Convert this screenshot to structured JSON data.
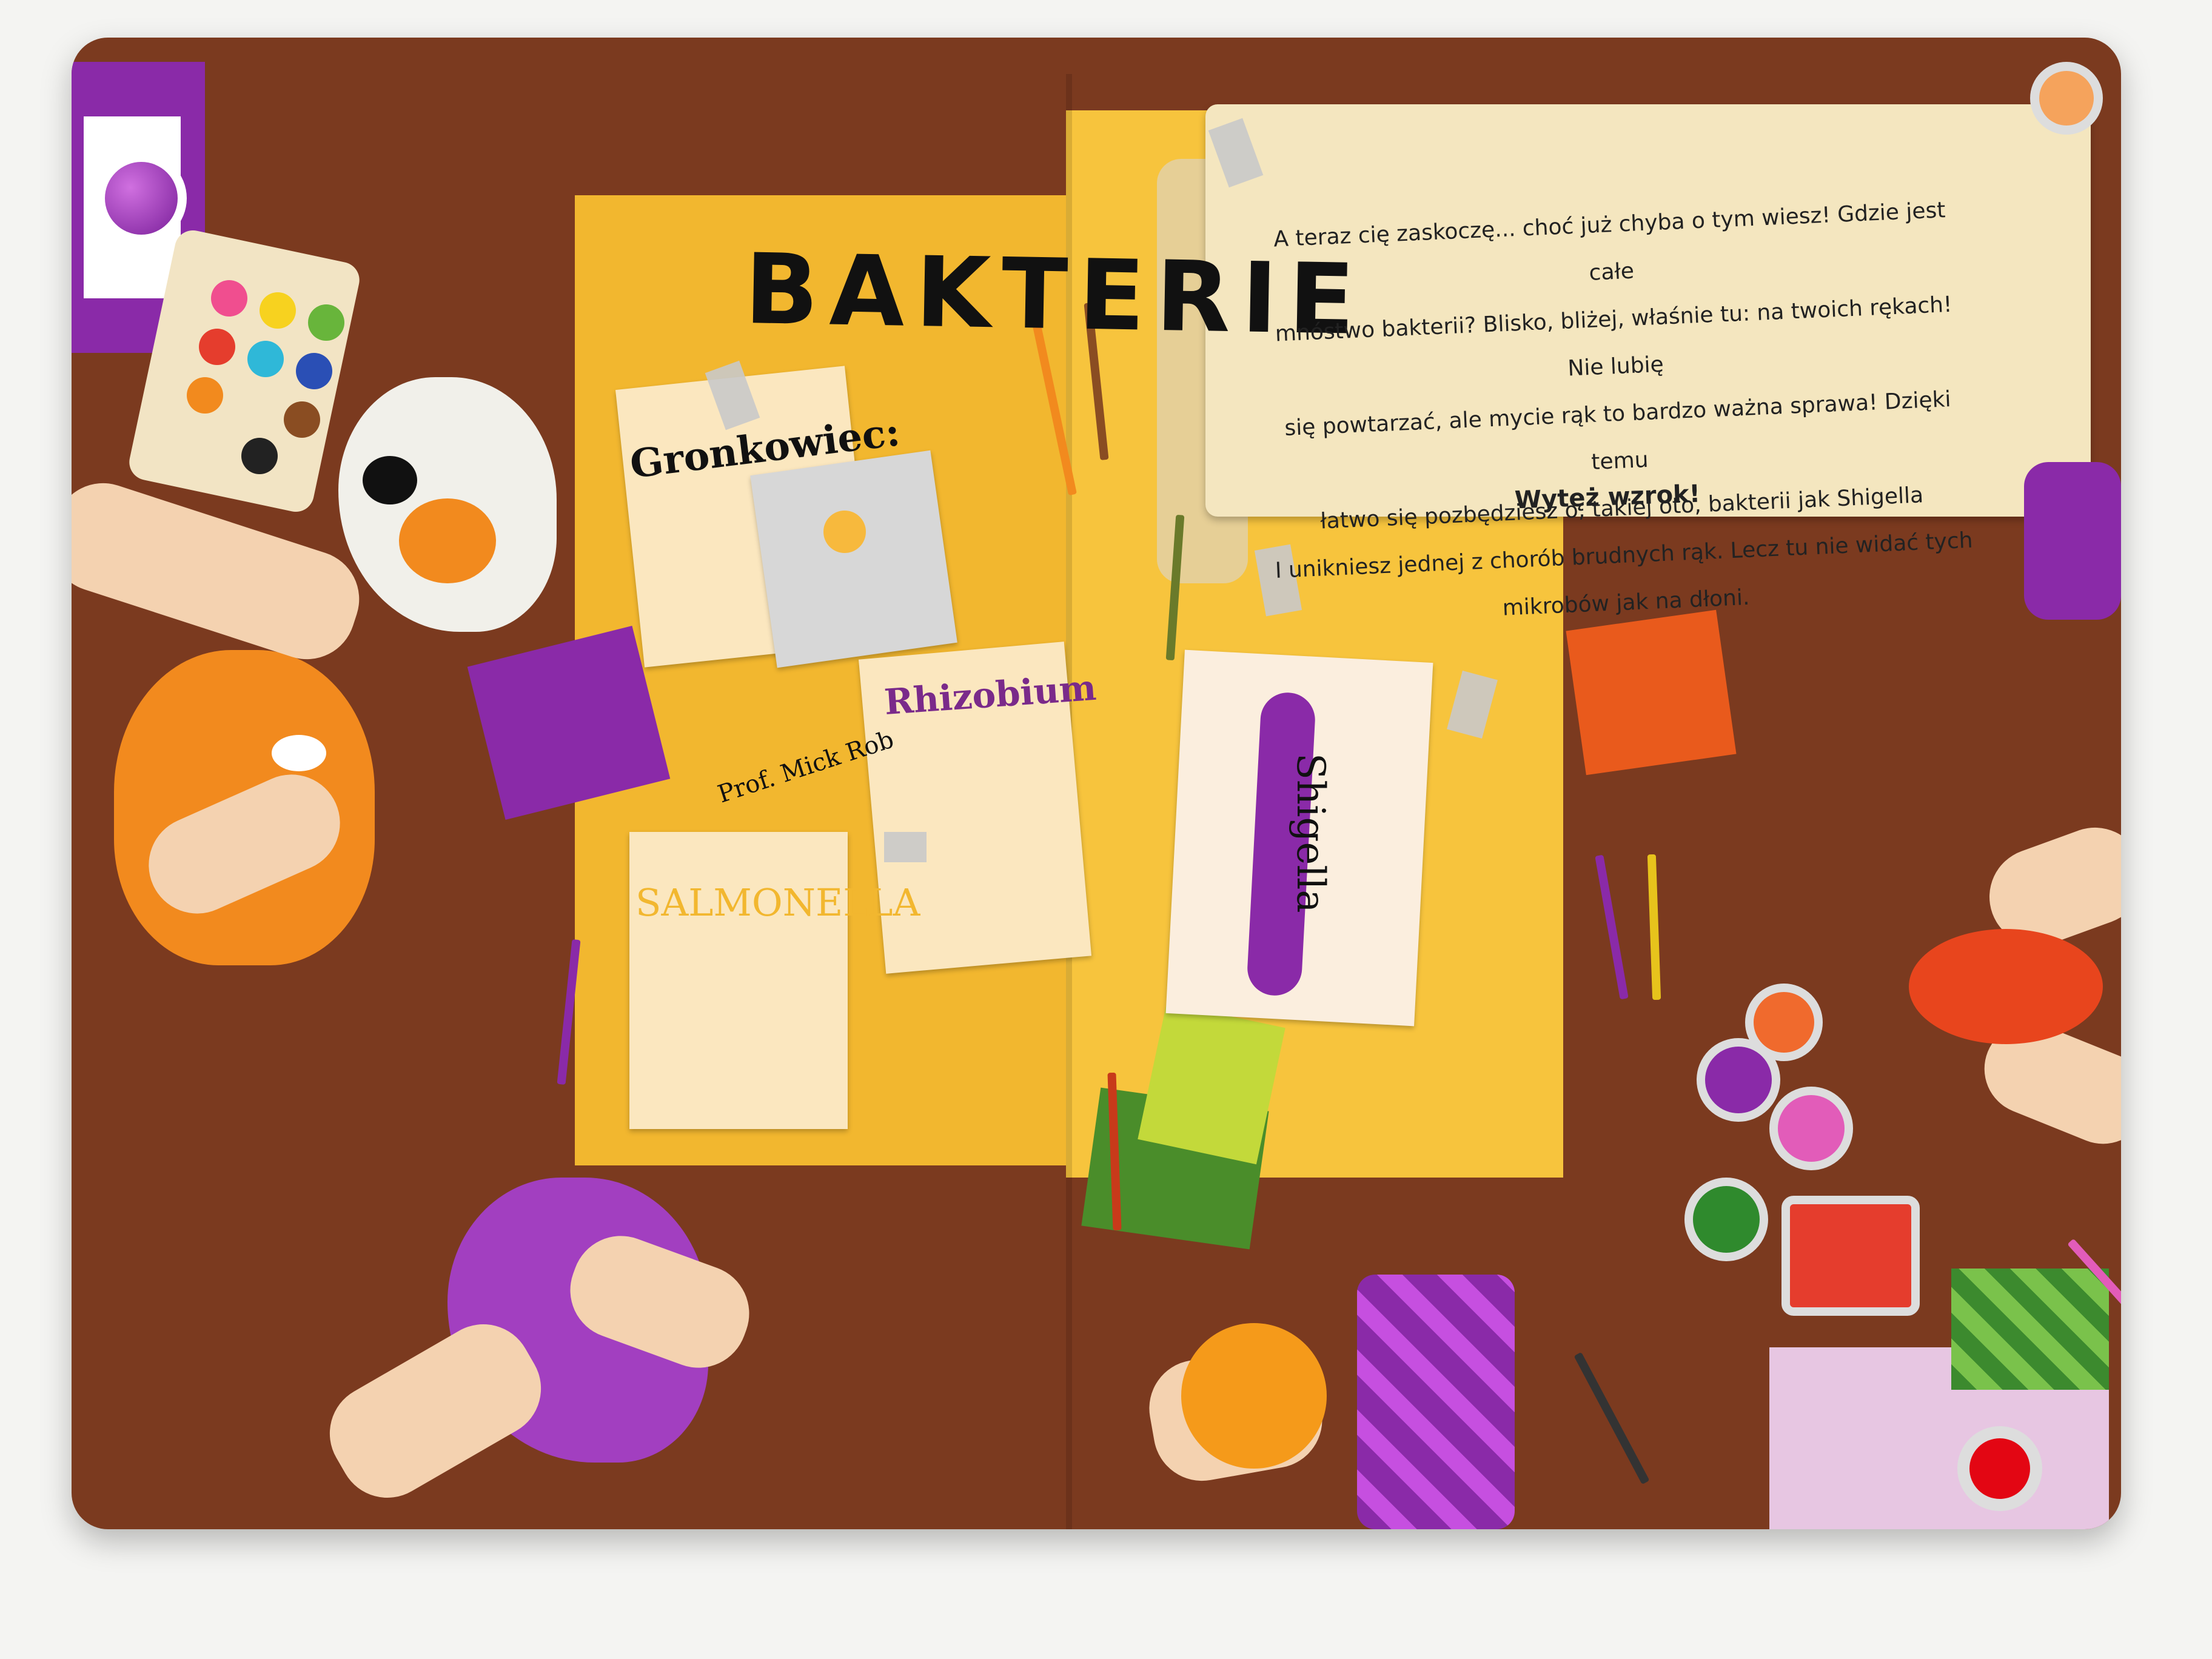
{
  "title": "BAKTERIE",
  "notes": {
    "gronkowiec": "Gronkowiec:",
    "rhizobium": "Rhizobium",
    "salmonella": "SALMONELLA",
    "shigella": "Shigella",
    "prof": "Prof. Mick Rob"
  },
  "scroll": {
    "lines": [
      "A teraz cię zaskoczę... choć już chyba o tym wiesz! Gdzie jest całe",
      "mnóstwo bakterii? Blisko, bliżej, właśnie tu: na twoich rękach! Nie lubię",
      "się powtarzać, ale mycie rąk to bardzo ważna sprawa! Dzięki temu",
      "łatwo się pozbędziesz o, takiej oto, bakterii jak Shigella",
      "I unikniesz jednej z chorób brudnych rąk. Lecz tu nie widać tych",
      "mikrobów jak na dłoni."
    ],
    "emphasis": "Wytęż wzrok!"
  },
  "colors": {
    "table": "#7b3a1f",
    "yellow": "#f2b72f",
    "purple": "#8a2aa8",
    "orange": "#f28a1e",
    "paper": "#fbe7bf"
  }
}
